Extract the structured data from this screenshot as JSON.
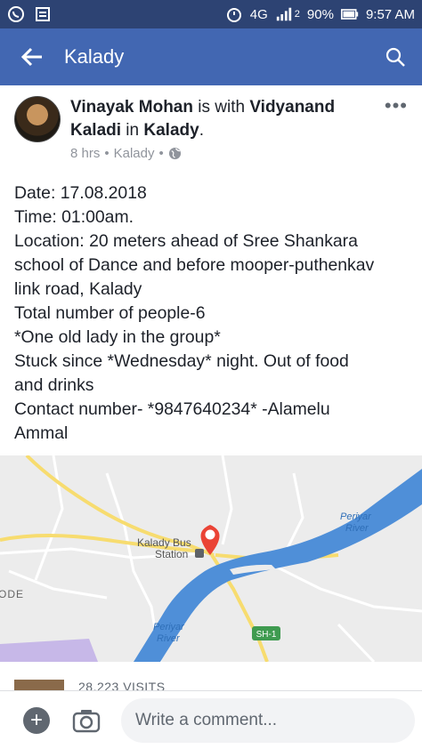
{
  "status_bar": {
    "network": "4G",
    "sim_slot": "2",
    "battery": "90%",
    "time": "9:57 AM",
    "icons": [
      "whatsapp-icon",
      "news-icon",
      "alarm-icon",
      "signal-icon",
      "battery-icon"
    ]
  },
  "app_bar": {
    "title": "Kalady",
    "back_icon": "arrow-left-icon",
    "search_icon": "search-icon"
  },
  "post": {
    "author": "Vinayak Mohan",
    "with_text": " is with ",
    "tagged": "Vidyanand Kaladi",
    "in_text": " in ",
    "place": "Kalady",
    "period": ".",
    "time_ago": "8 hrs",
    "location": "Kalady",
    "privacy_icon": "globe-icon",
    "more_label": "•••",
    "body_lines": [
      "Date: 17.08.2018",
      "Time: 01:00am.",
      "Location: 20 meters ahead of Sree Shankara",
      "school of Dance and before mooper-puthenkav",
      "link road, Kalady",
      "Total number of people-6",
      "*One old lady  in the group*",
      "Stuck since *Wednesday* night. Out of food",
      "and drinks",
      "Contact number- *9847640234* -Alamelu",
      "Ammal"
    ]
  },
  "map": {
    "labels": {
      "station_line1": "Kalady Bus",
      "station_line2": "Station",
      "river_top_line1": "Periyar",
      "river_top_line2": "River",
      "river_bottom_line1": "Periyar",
      "river_bottom_line2": "River",
      "road_badge": "SH-1",
      "left_edge": "ODE"
    },
    "colors": {
      "river": "#4f8fd8",
      "land": "#ececec",
      "road_major": "#f7dc6f",
      "road_minor": "#ffffff",
      "pin": "#ea4335",
      "park": "#c7b8e8"
    }
  },
  "visits": {
    "text": "28,223 VISITS"
  },
  "comment_bar": {
    "placeholder": "Write a comment...",
    "plus_label": "+"
  }
}
